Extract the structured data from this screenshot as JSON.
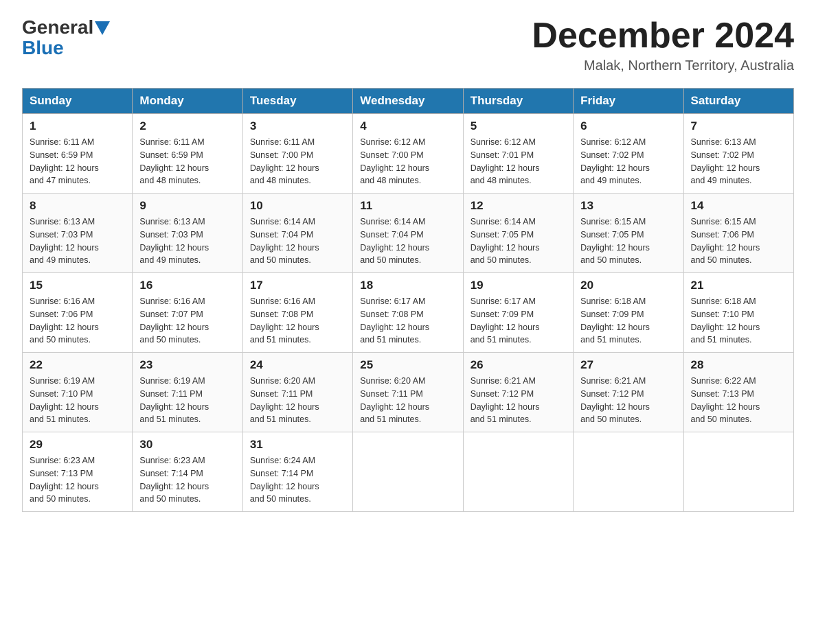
{
  "header": {
    "logo_general": "General",
    "logo_blue": "Blue",
    "month_title": "December 2024",
    "location": "Malak, Northern Territory, Australia"
  },
  "weekdays": [
    "Sunday",
    "Monday",
    "Tuesday",
    "Wednesday",
    "Thursday",
    "Friday",
    "Saturday"
  ],
  "weeks": [
    [
      {
        "day": "1",
        "sunrise": "6:11 AM",
        "sunset": "6:59 PM",
        "daylight": "12 hours and 47 minutes."
      },
      {
        "day": "2",
        "sunrise": "6:11 AM",
        "sunset": "6:59 PM",
        "daylight": "12 hours and 48 minutes."
      },
      {
        "day": "3",
        "sunrise": "6:11 AM",
        "sunset": "7:00 PM",
        "daylight": "12 hours and 48 minutes."
      },
      {
        "day": "4",
        "sunrise": "6:12 AM",
        "sunset": "7:00 PM",
        "daylight": "12 hours and 48 minutes."
      },
      {
        "day": "5",
        "sunrise": "6:12 AM",
        "sunset": "7:01 PM",
        "daylight": "12 hours and 48 minutes."
      },
      {
        "day": "6",
        "sunrise": "6:12 AM",
        "sunset": "7:02 PM",
        "daylight": "12 hours and 49 minutes."
      },
      {
        "day": "7",
        "sunrise": "6:13 AM",
        "sunset": "7:02 PM",
        "daylight": "12 hours and 49 minutes."
      }
    ],
    [
      {
        "day": "8",
        "sunrise": "6:13 AM",
        "sunset": "7:03 PM",
        "daylight": "12 hours and 49 minutes."
      },
      {
        "day": "9",
        "sunrise": "6:13 AM",
        "sunset": "7:03 PM",
        "daylight": "12 hours and 49 minutes."
      },
      {
        "day": "10",
        "sunrise": "6:14 AM",
        "sunset": "7:04 PM",
        "daylight": "12 hours and 50 minutes."
      },
      {
        "day": "11",
        "sunrise": "6:14 AM",
        "sunset": "7:04 PM",
        "daylight": "12 hours and 50 minutes."
      },
      {
        "day": "12",
        "sunrise": "6:14 AM",
        "sunset": "7:05 PM",
        "daylight": "12 hours and 50 minutes."
      },
      {
        "day": "13",
        "sunrise": "6:15 AM",
        "sunset": "7:05 PM",
        "daylight": "12 hours and 50 minutes."
      },
      {
        "day": "14",
        "sunrise": "6:15 AM",
        "sunset": "7:06 PM",
        "daylight": "12 hours and 50 minutes."
      }
    ],
    [
      {
        "day": "15",
        "sunrise": "6:16 AM",
        "sunset": "7:06 PM",
        "daylight": "12 hours and 50 minutes."
      },
      {
        "day": "16",
        "sunrise": "6:16 AM",
        "sunset": "7:07 PM",
        "daylight": "12 hours and 50 minutes."
      },
      {
        "day": "17",
        "sunrise": "6:16 AM",
        "sunset": "7:08 PM",
        "daylight": "12 hours and 51 minutes."
      },
      {
        "day": "18",
        "sunrise": "6:17 AM",
        "sunset": "7:08 PM",
        "daylight": "12 hours and 51 minutes."
      },
      {
        "day": "19",
        "sunrise": "6:17 AM",
        "sunset": "7:09 PM",
        "daylight": "12 hours and 51 minutes."
      },
      {
        "day": "20",
        "sunrise": "6:18 AM",
        "sunset": "7:09 PM",
        "daylight": "12 hours and 51 minutes."
      },
      {
        "day": "21",
        "sunrise": "6:18 AM",
        "sunset": "7:10 PM",
        "daylight": "12 hours and 51 minutes."
      }
    ],
    [
      {
        "day": "22",
        "sunrise": "6:19 AM",
        "sunset": "7:10 PM",
        "daylight": "12 hours and 51 minutes."
      },
      {
        "day": "23",
        "sunrise": "6:19 AM",
        "sunset": "7:11 PM",
        "daylight": "12 hours and 51 minutes."
      },
      {
        "day": "24",
        "sunrise": "6:20 AM",
        "sunset": "7:11 PM",
        "daylight": "12 hours and 51 minutes."
      },
      {
        "day": "25",
        "sunrise": "6:20 AM",
        "sunset": "7:11 PM",
        "daylight": "12 hours and 51 minutes."
      },
      {
        "day": "26",
        "sunrise": "6:21 AM",
        "sunset": "7:12 PM",
        "daylight": "12 hours and 51 minutes."
      },
      {
        "day": "27",
        "sunrise": "6:21 AM",
        "sunset": "7:12 PM",
        "daylight": "12 hours and 50 minutes."
      },
      {
        "day": "28",
        "sunrise": "6:22 AM",
        "sunset": "7:13 PM",
        "daylight": "12 hours and 50 minutes."
      }
    ],
    [
      {
        "day": "29",
        "sunrise": "6:23 AM",
        "sunset": "7:13 PM",
        "daylight": "12 hours and 50 minutes."
      },
      {
        "day": "30",
        "sunrise": "6:23 AM",
        "sunset": "7:14 PM",
        "daylight": "12 hours and 50 minutes."
      },
      {
        "day": "31",
        "sunrise": "6:24 AM",
        "sunset": "7:14 PM",
        "daylight": "12 hours and 50 minutes."
      },
      null,
      null,
      null,
      null
    ]
  ],
  "labels": {
    "sunrise": "Sunrise:",
    "sunset": "Sunset:",
    "daylight": "Daylight:"
  }
}
